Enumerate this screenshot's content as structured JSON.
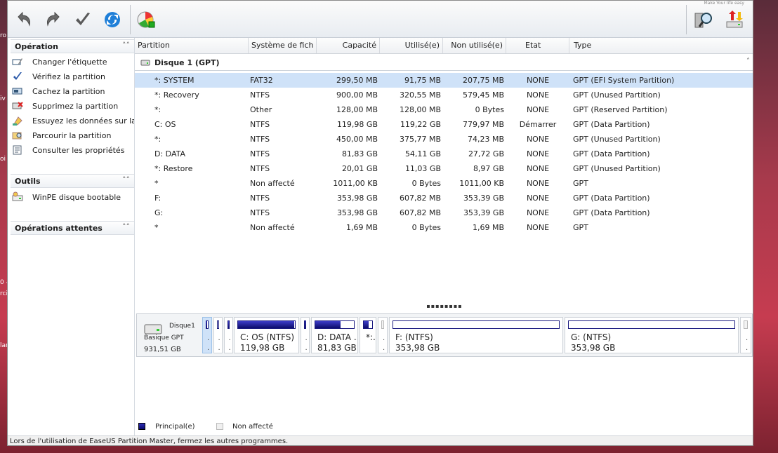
{
  "desktop": {
    "left_fragments": [
      "ro",
      "iv",
      "oi",
      "0 -",
      "rci",
      "lar"
    ]
  },
  "toolbar": {
    "undo_label": "Undo",
    "redo_label": "Redo",
    "apply_label": "Apply",
    "refresh_label": "Refresh",
    "corner_text": "Make Your life easy"
  },
  "sidebar": {
    "operation": {
      "title": "Opération",
      "items": [
        {
          "label": "Changer l'étiquette",
          "icon": "label-edit-icon"
        },
        {
          "label": "Vérifiez la partition",
          "icon": "check-icon"
        },
        {
          "label": "Cachez la partition",
          "icon": "hide-icon"
        },
        {
          "label": "Supprimez la partition",
          "icon": "delete-icon"
        },
        {
          "label": "Essuyez les données sur la partition",
          "icon": "wipe-icon"
        },
        {
          "label": "Parcourir la partition",
          "icon": "browse-icon"
        },
        {
          "label": "Consulter les propriétés",
          "icon": "properties-icon"
        }
      ]
    },
    "tools": {
      "title": "Outils",
      "items": [
        {
          "label": "WinPE disque bootable",
          "icon": "disk-icon"
        }
      ]
    },
    "pending": {
      "title": "Opérations attentes"
    }
  },
  "grid": {
    "columns": [
      "Partition",
      "Système de fich",
      "Capacité",
      "Utilisé(e)",
      "Non utilisé(e)",
      "Etat",
      "Type"
    ],
    "disk_label": "Disque 1 (GPT)",
    "rows": [
      {
        "partition": "*: SYSTEM",
        "fs": "FAT32",
        "capacity": "299,50 MB",
        "used": "91,75 MB",
        "unused": "207,75 MB",
        "state": "NONE",
        "type": "GPT (EFI System Partition)",
        "selected": true
      },
      {
        "partition": "*: Recovery",
        "fs": "NTFS",
        "capacity": "900,00 MB",
        "used": "320,55 MB",
        "unused": "579,45 MB",
        "state": "NONE",
        "type": "GPT (Unused Partition)"
      },
      {
        "partition": "*:",
        "fs": "Other",
        "capacity": "128,00 MB",
        "used": "128,00 MB",
        "unused": "0 Bytes",
        "state": "NONE",
        "type": "GPT (Reserved Partition)"
      },
      {
        "partition": "C: OS",
        "fs": "NTFS",
        "capacity": "119,98 GB",
        "used": "119,22 GB",
        "unused": "779,97 MB",
        "state": "Démarrer",
        "type": "GPT (Data Partition)"
      },
      {
        "partition": "*:",
        "fs": "NTFS",
        "capacity": "450,00 MB",
        "used": "375,77 MB",
        "unused": "74,23 MB",
        "state": "NONE",
        "type": "GPT (Unused Partition)"
      },
      {
        "partition": "D: DATA",
        "fs": "NTFS",
        "capacity": "81,83 GB",
        "used": "54,11 GB",
        "unused": "27,72 GB",
        "state": "NONE",
        "type": "GPT (Data Partition)"
      },
      {
        "partition": "*: Restore",
        "fs": "NTFS",
        "capacity": "20,01 GB",
        "used": "11,03 GB",
        "unused": "8,97 GB",
        "state": "NONE",
        "type": "GPT (Unused Partition)"
      },
      {
        "partition": "*",
        "fs": "Non affecté",
        "capacity": "1011,00 KB",
        "used": "0 Bytes",
        "unused": "1011,00 KB",
        "state": "NONE",
        "type": "GPT"
      },
      {
        "partition": "F:",
        "fs": "NTFS",
        "capacity": "353,98 GB",
        "used": "607,82 MB",
        "unused": "353,39 GB",
        "state": "NONE",
        "type": "GPT (Data Partition)"
      },
      {
        "partition": "G:",
        "fs": "NTFS",
        "capacity": "353,98 GB",
        "used": "607,82 MB",
        "unused": "353,39 GB",
        "state": "NONE",
        "type": "GPT (Data Partition)"
      },
      {
        "partition": "*",
        "fs": "Non affecté",
        "capacity": "1,69 MB",
        "used": "0 Bytes",
        "unused": "1,69 MB",
        "state": "NONE",
        "type": "GPT"
      }
    ]
  },
  "diskmap": {
    "disk_name": "Disque1",
    "disk_type": "Basique GPT",
    "disk_size": "931,51 GB",
    "segments": [
      {
        "name": "",
        "size": "",
        "kind": "selected",
        "fill": 0.31
      },
      {
        "name": "",
        "size": "",
        "kind": "tiny",
        "fill": 0.36
      },
      {
        "name": "",
        "size": "",
        "kind": "tiny",
        "fill": 1
      },
      {
        "name": "C: OS (NTFS)",
        "size": "119,98 GB",
        "kind": "primary",
        "fill": 0.99
      },
      {
        "name": "",
        "size": "",
        "kind": "tiny",
        "fill": 0.84
      },
      {
        "name": "D: DATA ...",
        "size": "81,83 GB",
        "kind": "primary",
        "fill": 0.66
      },
      {
        "name": "*:...",
        "size": "",
        "kind": "small",
        "fill": 0.55
      },
      {
        "name": "",
        "size": "",
        "kind": "unalloc",
        "fill": 0
      },
      {
        "name": "F: (NTFS)",
        "size": "353,98 GB",
        "kind": "primary",
        "fill": 0.0017
      },
      {
        "name": "G: (NTFS)",
        "size": "353,98 GB",
        "kind": "primary",
        "fill": 0.0017
      },
      {
        "name": "",
        "size": "",
        "kind": "unalloc",
        "fill": 0
      }
    ]
  },
  "legend": {
    "primary_label": "Principal(e)",
    "unallocated_label": "Non affecté"
  },
  "status": {
    "text": "Lors de l'utilisation de EaseUS Partition Master, fermez les autres programmes."
  },
  "colors": {
    "selection": "#cfe2f8",
    "primary_fill": "#1a1a9c",
    "header_bg": "#eef0f3"
  }
}
